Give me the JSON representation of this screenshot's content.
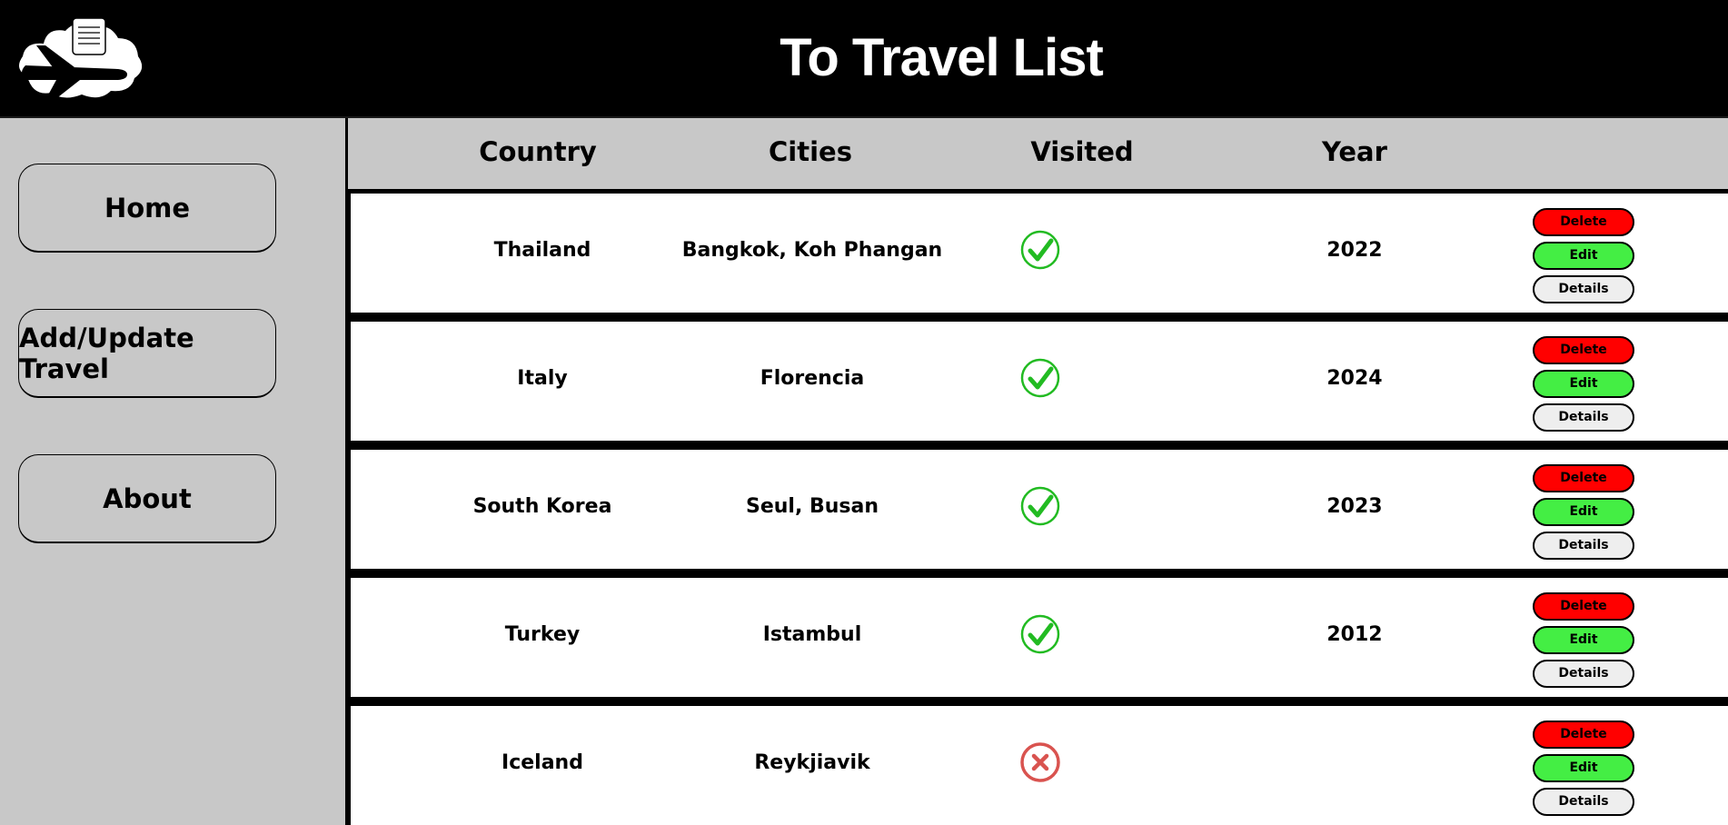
{
  "header": {
    "title": "To Travel List",
    "logo_icon": "plane-cloud-logo-icon"
  },
  "sidebar": {
    "items": [
      {
        "label": "Home"
      },
      {
        "label": "Add/Update Travel"
      },
      {
        "label": "About"
      }
    ]
  },
  "table": {
    "columns": [
      "Country",
      "Cities",
      "Visited",
      "Year"
    ],
    "actions": {
      "delete": "Delete",
      "edit": "Edit",
      "details": "Details"
    },
    "rows": [
      {
        "country": "Thailand",
        "cities": "Bangkok, Koh Phangan",
        "visited": true,
        "year": "2022"
      },
      {
        "country": "Italy",
        "cities": "Florencia",
        "visited": true,
        "year": "2024"
      },
      {
        "country": "South Korea",
        "cities": "Seul, Busan",
        "visited": true,
        "year": "2023"
      },
      {
        "country": "Turkey",
        "cities": "Istambul",
        "visited": true,
        "year": "2012"
      },
      {
        "country": "Iceland",
        "cities": "Reykjiavik",
        "visited": false,
        "year": ""
      }
    ]
  },
  "colors": {
    "visited_yes": "#22bb22",
    "visited_no": "#d9534f",
    "delete": "#ff0000",
    "edit": "#44ee44",
    "details": "#eeeeee"
  }
}
